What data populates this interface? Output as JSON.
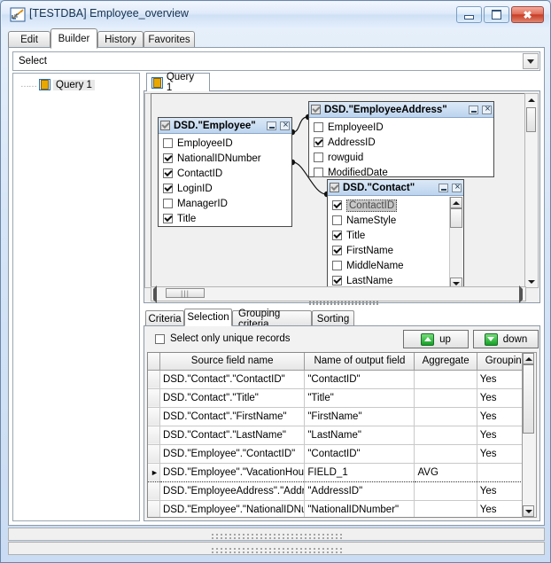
{
  "window": {
    "title": "[TESTDBA] Employee_overview",
    "icon": "query-builder-icon",
    "minimize_label": "Minimize",
    "maximize_label": "Restore",
    "close_label": "✖"
  },
  "main_tabs": [
    {
      "label": "Edit",
      "active": false
    },
    {
      "label": "Builder",
      "active": true
    },
    {
      "label": "History",
      "active": false
    },
    {
      "label": "Favorites",
      "active": false
    }
  ],
  "statement_bar": {
    "value": "Select",
    "dropdown_icon": "chevron-down-icon"
  },
  "tree": {
    "items": [
      {
        "label": "Query 1",
        "icon": "query-icon"
      }
    ]
  },
  "query_tabs": [
    {
      "label": "Query 1",
      "icon": "query-icon",
      "active": true
    }
  ],
  "diagram": {
    "tables": [
      {
        "name": "DSD.\"Employee\"",
        "header_checked": true,
        "fields": [
          {
            "name": "EmployeeID",
            "checked": false
          },
          {
            "name": "NationalIDNumber",
            "checked": true
          },
          {
            "name": "ContactID",
            "checked": true
          },
          {
            "name": "LoginID",
            "checked": true
          },
          {
            "name": "ManagerID",
            "checked": false
          },
          {
            "name": "Title",
            "checked": true
          }
        ]
      },
      {
        "name": "DSD.\"EmployeeAddress\"",
        "header_checked": true,
        "fields": [
          {
            "name": "EmployeeID",
            "checked": false
          },
          {
            "name": "AddressID",
            "checked": true
          },
          {
            "name": "rowguid",
            "checked": false
          },
          {
            "name": "ModifiedDate",
            "checked": false
          }
        ]
      },
      {
        "name": "DSD.\"Contact\"",
        "header_checked": true,
        "fields": [
          {
            "name": "ContactID",
            "checked": true,
            "selected": true
          },
          {
            "name": "NameStyle",
            "checked": false
          },
          {
            "name": "Title",
            "checked": true
          },
          {
            "name": "FirstName",
            "checked": true
          },
          {
            "name": "MiddleName",
            "checked": false
          },
          {
            "name": "LastName",
            "checked": true
          }
        ]
      }
    ]
  },
  "bottom_tabs": [
    {
      "label": "Criteria",
      "active": false
    },
    {
      "label": "Selection",
      "active": true
    },
    {
      "label": "Grouping criteria",
      "active": false
    },
    {
      "label": "Sorting",
      "active": false
    }
  ],
  "selection_panel": {
    "unique_checkbox_label": "Select only unique records",
    "unique_checked": false,
    "up_button": "up",
    "down_button": "down",
    "columns": [
      "Source field name",
      "Name of output field",
      "Aggregate",
      "Grouping"
    ],
    "rows": [
      {
        "current": false,
        "source": "DSD.\"Contact\".\"ContactID\"",
        "output": "\"ContactID\"",
        "aggregate": "",
        "grouping": "Yes"
      },
      {
        "current": false,
        "source": "DSD.\"Contact\".\"Title\"",
        "output": "\"Title\"",
        "aggregate": "",
        "grouping": "Yes"
      },
      {
        "current": false,
        "source": "DSD.\"Contact\".\"FirstName\"",
        "output": "\"FirstName\"",
        "aggregate": "",
        "grouping": "Yes"
      },
      {
        "current": false,
        "source": "DSD.\"Contact\".\"LastName\"",
        "output": "\"LastName\"",
        "aggregate": "",
        "grouping": "Yes"
      },
      {
        "current": false,
        "source": "DSD.\"Employee\".\"ContactID\"",
        "output": "\"ContactID\"",
        "aggregate": "",
        "grouping": "Yes"
      },
      {
        "current": true,
        "source": "DSD.\"Employee\".\"VacationHours\"",
        "output": "FIELD_1",
        "aggregate": "AVG",
        "grouping": ""
      },
      {
        "current": false,
        "source": "DSD.\"EmployeeAddress\".\"AddressID\"",
        "output": "\"AddressID\"",
        "aggregate": "",
        "grouping": "Yes"
      },
      {
        "current": false,
        "source": "DSD.\"Employee\".\"NationalIDNumber\"",
        "output": "\"NationalIDNumber\"",
        "aggregate": "",
        "grouping": "Yes"
      }
    ]
  },
  "colors": {
    "title_accent": "#cfe0f5",
    "close_button": "#c93c26",
    "table_header": "#bcd4ee",
    "button_green": "#12a224",
    "window_frame": "#6b86a8"
  }
}
